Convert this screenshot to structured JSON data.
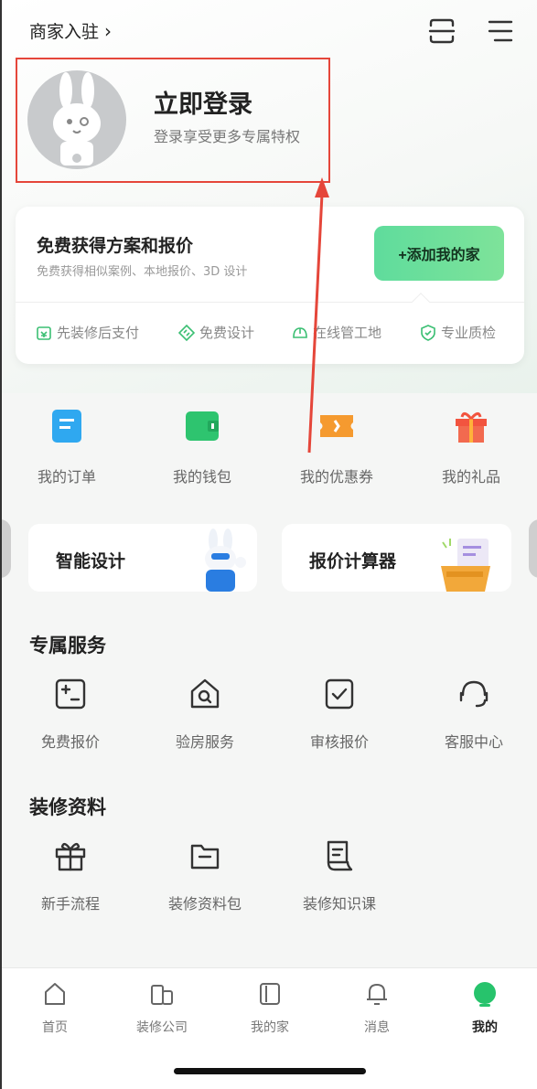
{
  "header": {
    "merchant_label": "商家入驻",
    "scan_icon": "scan-icon",
    "menu_icon": "menu-icon"
  },
  "login": {
    "title": "立即登录",
    "subtitle": "登录享受更多专属特权"
  },
  "plan_card": {
    "title": "免费获得方案和报价",
    "subtitle": "免费获得相似案例、本地报价、3D 设计",
    "button": "+添加我的家",
    "features": [
      {
        "label": "先装修后支付",
        "icon": "pay-icon"
      },
      {
        "label": "免费设计",
        "icon": "design-icon"
      },
      {
        "label": "在线管工地",
        "icon": "helmet-icon"
      },
      {
        "label": "专业质检",
        "icon": "shield-check-icon"
      }
    ]
  },
  "quick_links": [
    {
      "label": "我的订单",
      "icon": "order-icon",
      "color": "#2fa8f0"
    },
    {
      "label": "我的钱包",
      "icon": "wallet-icon",
      "color": "#2ec46f"
    },
    {
      "label": "我的优惠券",
      "icon": "coupon-icon",
      "color": "#f59a2f"
    },
    {
      "label": "我的礼品",
      "icon": "gift-icon",
      "color": "#f2543f"
    }
  ],
  "promos": [
    {
      "title": "智能设计"
    },
    {
      "title": "报价计算器"
    }
  ],
  "services": {
    "title": "专属服务",
    "items": [
      {
        "label": "免费报价"
      },
      {
        "label": "验房服务"
      },
      {
        "label": "审核报价"
      },
      {
        "label": "客服中心"
      }
    ]
  },
  "materials": {
    "title": "装修资料",
    "items": [
      {
        "label": "新手流程"
      },
      {
        "label": "装修资料包"
      },
      {
        "label": "装修知识课"
      }
    ]
  },
  "nav": {
    "items": [
      {
        "label": "首页"
      },
      {
        "label": "装修公司"
      },
      {
        "label": "我的家"
      },
      {
        "label": "消息"
      },
      {
        "label": "我的"
      }
    ],
    "active_color": "#27c36c"
  }
}
